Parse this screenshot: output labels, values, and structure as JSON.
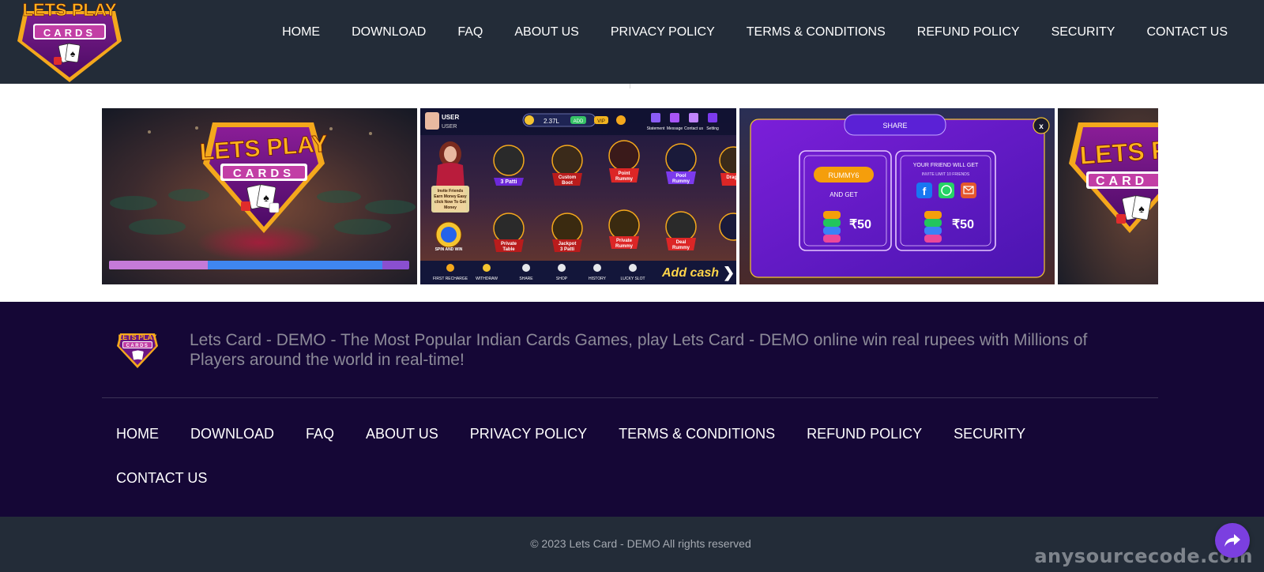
{
  "brand": {
    "logo_line1": "LETS PLAY",
    "logo_line2": "CARDS"
  },
  "header": {
    "nav": [
      "HOME",
      "DOWNLOAD",
      "FAQ",
      "ABOUT US",
      "PRIVACY POLICY",
      "TERMS & CONDITIONS",
      "REFUND POLICY",
      "SECURITY",
      "CONTACT US"
    ]
  },
  "carousel": {
    "slides": [
      {
        "type": "logo-banner",
        "title_line1": "LETS PLAY",
        "title_line2": "CARDS"
      },
      {
        "type": "game-lobby",
        "user_name": "USER",
        "user_sub": "USER",
        "balance": "2.37L",
        "add_label": "ADD",
        "vip_label": "VIP",
        "top_icons": [
          "Statement",
          "Message",
          "Contact us",
          "Setting"
        ],
        "promo_text": "Invite Friends Earn Money Easy click Now To Get Money",
        "spin_label": "SPIN AND WIN",
        "games": [
          "3 Patti",
          "Custom Boot",
          "Point Rummy",
          "Pool Rummy",
          "Dragon Ti",
          "Private Table",
          "Jackpot 3 Patti",
          "Private Rummy",
          "Deal Rummy",
          "B"
        ],
        "bottom_bar": [
          "FIRST RECHARGE",
          "WITHDRAW",
          "SHARE",
          "SHOP",
          "HISTORY",
          "LUCKY SLOT"
        ],
        "add_cash": "Add cash"
      },
      {
        "type": "share-dialog",
        "title": "SHARE",
        "close": "x",
        "code": "RUMMY6",
        "and_get": "AND GET",
        "reward_left": "₹50",
        "friend_title": "YOUR FRIEND WILL GET",
        "friend_sub": "INVITE LIMIT 10 FRIENDS",
        "reward_right": "₹50"
      },
      {
        "type": "logo-banner",
        "title_line1": "LETS PL",
        "title_line2": "CARD"
      }
    ],
    "progress": {
      "played_fraction": 0.33,
      "buffered_fraction": 0.91
    }
  },
  "footer": {
    "description": "Lets Card - DEMO - The Most Popular Indian Cards Games, play Lets Card - DEMO online win real rupees with Millions of Players around the world in real-time!",
    "nav": [
      "HOME",
      "DOWNLOAD",
      "FAQ",
      "ABOUT US",
      "PRIVACY POLICY",
      "TERMS & CONDITIONS",
      "REFUND POLICY",
      "SECURITY",
      "CONTACT US"
    ]
  },
  "bottom": {
    "copyright": "© 2023 Lets Card - DEMO All rights reserved",
    "watermark": "anysourcecode.com"
  },
  "icons": {
    "share_fab": "share-arrow-icon"
  },
  "colors": {
    "header_bg": "#232c38",
    "footer_bg": "#150736",
    "accent_purple": "#7b3fe0",
    "logo_gold": "#f4a81c"
  }
}
